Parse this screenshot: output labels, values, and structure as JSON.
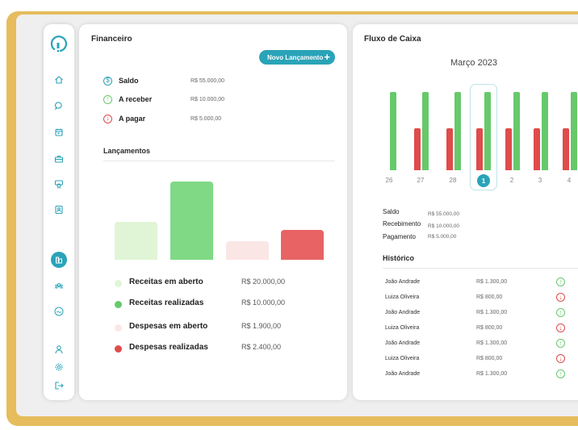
{
  "colors": {
    "accent": "#2aa3b8",
    "green": "#66c96b",
    "red": "#e04b4b",
    "light_green": "#e0f5d6",
    "light_red": "#fbe6e6",
    "frame": "#e6bc5c"
  },
  "sidebar": {
    "icons": [
      "home-icon",
      "chat-icon",
      "calendar-icon",
      "briefcase-icon",
      "certificate-icon",
      "contact-card-icon",
      "finance-icon",
      "team-icon",
      "handshake-icon",
      "user-icon",
      "gear-icon",
      "logout-icon"
    ],
    "active": "finance-icon"
  },
  "financeiro": {
    "title": "Financeiro",
    "new_button": "Novo Lançamento",
    "summary": [
      {
        "label": "Saldo",
        "value": "R$ 55.000,00",
        "icon": "dollar-icon"
      },
      {
        "label": "A receber",
        "value": "R$ 10.000,00",
        "icon": "arrow-up-icon"
      },
      {
        "label": "A pagar",
        "value": "R$ 5.000,00",
        "icon": "arrow-down-icon"
      }
    ],
    "lancamentos_title": "Lançamentos",
    "legend": [
      {
        "label": "Receitas em aberto",
        "value": "R$ 20.000,00",
        "color": "#e0f5d6"
      },
      {
        "label": "Receitas realizadas",
        "value": "R$ 10.000,00",
        "color": "#66c96b"
      },
      {
        "label": "Despesas em aberto",
        "value": "R$ 1.900,00",
        "color": "#fbe6e6"
      },
      {
        "label": "Despesas realizadas",
        "value": "R$ 2.400,00",
        "color": "#e04b4b"
      }
    ],
    "chart_bar_levels": [
      0.48,
      1.0,
      0.24,
      0.38
    ]
  },
  "fluxo": {
    "title": "Fluxo de Caixa",
    "month": "Março 2023",
    "days": [
      "26",
      "27",
      "28",
      "1",
      "2",
      "3",
      "4"
    ],
    "selected_day": "1",
    "summary": [
      {
        "label": "Saldo",
        "value": "R$ 55.000,00"
      },
      {
        "label": "Recebimento",
        "value": "R$ 10.000,00"
      },
      {
        "label": "Pagamento",
        "value": "R$ 5.000,00"
      }
    ],
    "historico_title": "Histórico",
    "historico": [
      {
        "name": "João Andrade",
        "value": "R$ 1.300,00",
        "type": "in"
      },
      {
        "name": "Luiza Oliveira",
        "value": "R$ 800,00",
        "type": "out"
      },
      {
        "name": "João Andrade",
        "value": "R$ 1.300,00",
        "type": "in"
      },
      {
        "name": "Luiza Oliveira",
        "value": "R$ 800,00",
        "type": "out"
      },
      {
        "name": "João Andrade",
        "value": "R$ 1.300,00",
        "type": "in"
      },
      {
        "name": "Luiza Oliveira",
        "value": "R$ 800,00",
        "type": "out"
      },
      {
        "name": "João Andrade",
        "value": "R$ 1.300,00",
        "type": "in"
      }
    ]
  }
}
